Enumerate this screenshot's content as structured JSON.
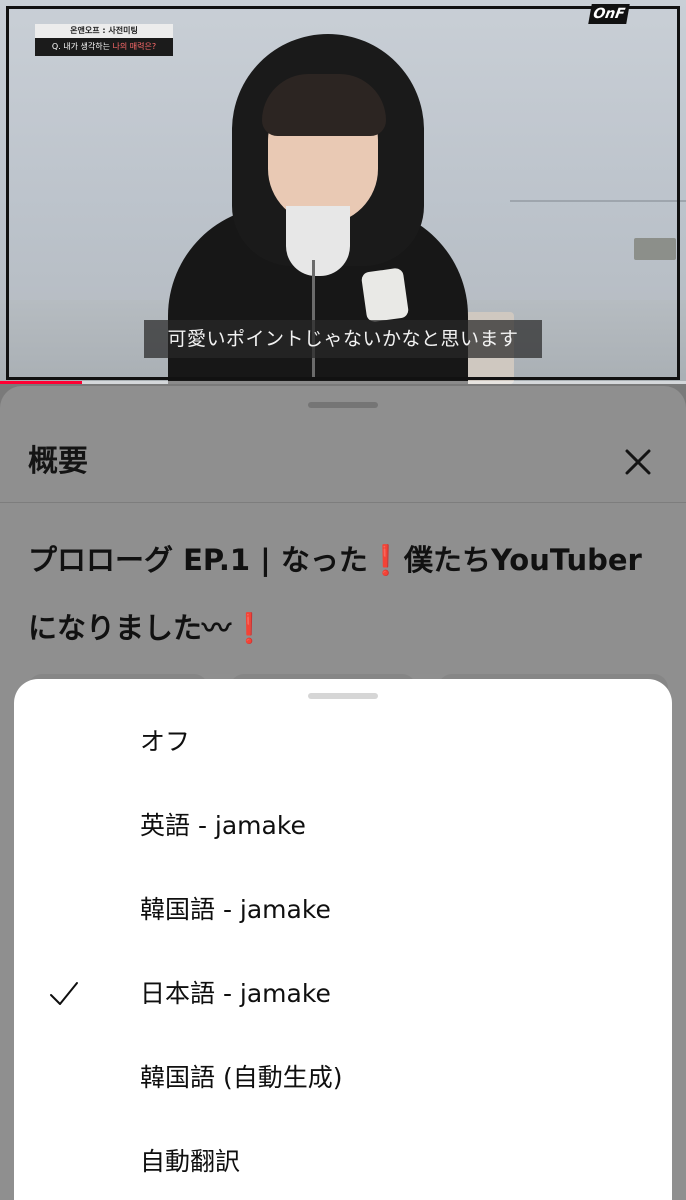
{
  "video": {
    "info_top": "온앤오프 : 사전미팅",
    "info_question_prefix": "Q. 내가 생각하는 ",
    "info_question_highlight": "나의 매력은?",
    "brand_logo": "OnF",
    "caption": "可愛いポイントじゃないかなと思います",
    "progress_fraction": 0.12,
    "colors": {
      "progress": "#ff0033"
    }
  },
  "description": {
    "title": "概要",
    "close_icon": "close-icon",
    "video_title_part1": "プロローグ EP.1 | なった",
    "video_title_part2": "僕たちYouTuberになりました〰",
    "exclamation": "❗"
  },
  "captions_menu": {
    "items": [
      {
        "label": "オフ",
        "selected": false
      },
      {
        "label": "英語 - jamake",
        "selected": false
      },
      {
        "label": "韓国語 - jamake",
        "selected": false
      },
      {
        "label": "日本語 - jamake",
        "selected": true
      },
      {
        "label": "韓国語 (自動生成)",
        "selected": false
      },
      {
        "label": "自動翻訳",
        "selected": false
      }
    ],
    "check_icon": "checkmark-icon"
  }
}
